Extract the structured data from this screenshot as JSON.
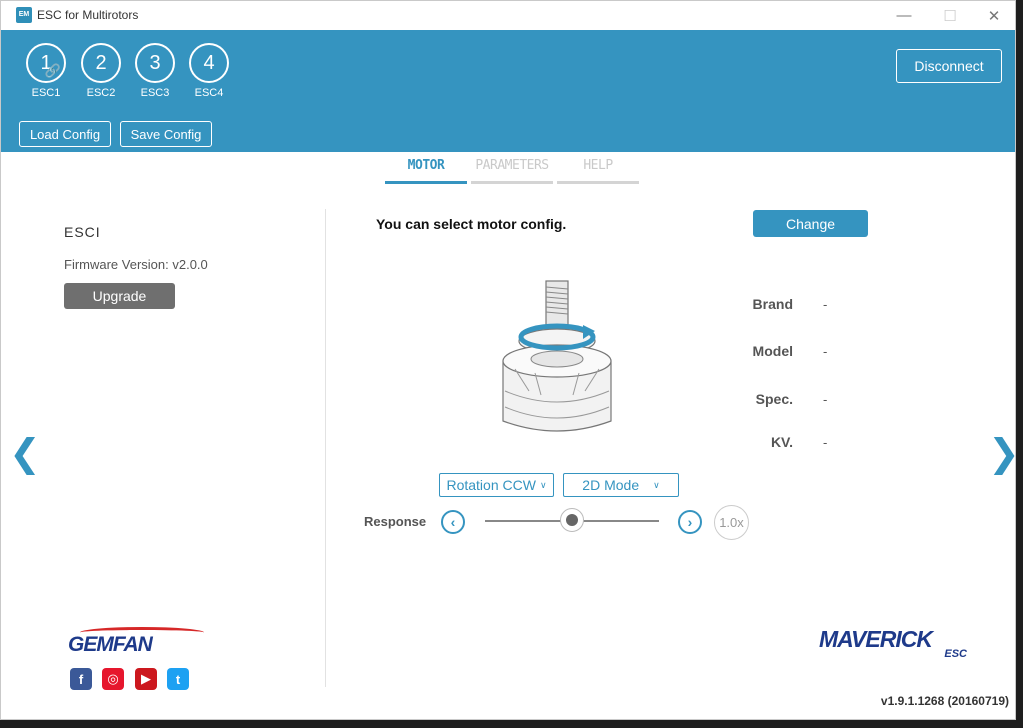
{
  "window": {
    "title": "ESC for Multirotors",
    "controls": {
      "minimize": "—",
      "maximize": "☐",
      "close": "✕"
    }
  },
  "header": {
    "escs": [
      {
        "number": "1",
        "label": "ESC1",
        "linked": true
      },
      {
        "number": "2",
        "label": "ESC2",
        "linked": false
      },
      {
        "number": "3",
        "label": "ESC3",
        "linked": false
      },
      {
        "number": "4",
        "label": "ESC4",
        "linked": false
      }
    ],
    "load_config": "Load Config",
    "save_config": "Save Config",
    "disconnect": "Disconnect",
    "accent_color": "#3594c0"
  },
  "tabs": [
    {
      "label": "MOTOR",
      "active": true
    },
    {
      "label": "PARAMETERS",
      "active": false
    },
    {
      "label": "HELP",
      "active": false
    }
  ],
  "left_panel": {
    "esc_name": "ESCI",
    "firmware_version": "Firmware Version: v2.0.0",
    "upgrade": "Upgrade"
  },
  "motor_panel": {
    "message": "You can select motor config.",
    "change": "Change",
    "specs": [
      {
        "label": "Brand",
        "value": "-"
      },
      {
        "label": "Model",
        "value": "-"
      },
      {
        "label": "Spec.",
        "value": "-"
      },
      {
        "label": "KV.",
        "value": "-"
      }
    ],
    "rotation": "Rotation CCW",
    "mode": "2D Mode",
    "response_label": "Response",
    "response_level": 0.5,
    "multiplier": "1.0x"
  },
  "footer": {
    "brand_left": "GEMFAN",
    "brand_right": "MAVERICK",
    "brand_right_sub": "ESC",
    "social": [
      {
        "name": "facebook-icon",
        "glyph": "f",
        "color": "#3b5998"
      },
      {
        "name": "weibo-icon",
        "glyph": "◎",
        "color": "#e6162d"
      },
      {
        "name": "youtube-icon",
        "glyph": "▶",
        "color": "#cc181e"
      },
      {
        "name": "twitter-icon",
        "glyph": "t",
        "color": "#1da1f2"
      }
    ],
    "version": "v1.9.1.1268 (20160719)"
  },
  "nav": {
    "prev": "❮",
    "next": "❯"
  }
}
